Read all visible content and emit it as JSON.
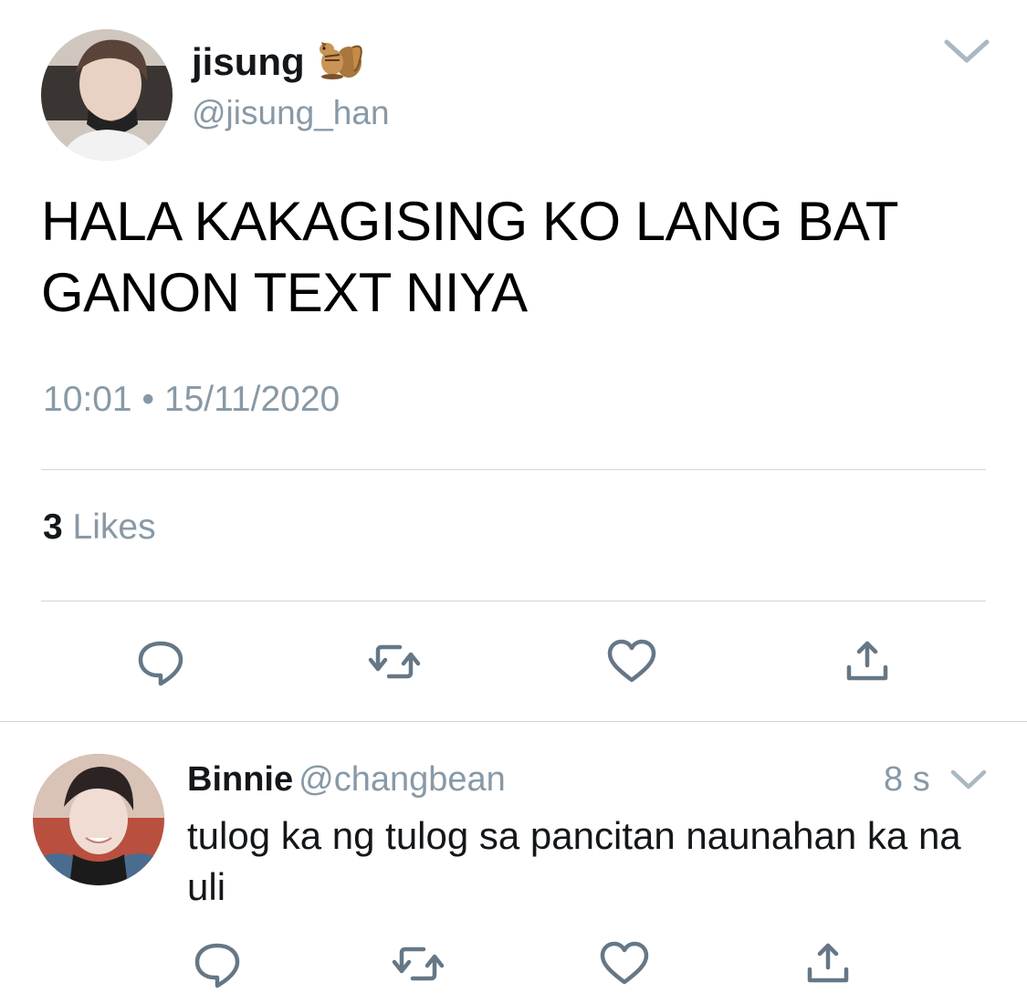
{
  "tweet": {
    "author": {
      "name": "jisung",
      "emoji": "chipmunk-emoji",
      "handle": "@jisung_han",
      "avatar": "profile-photo"
    },
    "text": "HALA KAKAGISING KO LANG BAT GANON TEXT NIYA",
    "timestamp": "10:01 • 15/11/2020",
    "likes": {
      "count": "3",
      "label": "Likes"
    },
    "actions": [
      "reply-icon",
      "retweet-icon",
      "like-icon",
      "share-icon"
    ],
    "menu_icon": "chevron-down-icon"
  },
  "reply": {
    "author": {
      "name": "Binnie",
      "handle": "@changbean",
      "avatar": "profile-photo"
    },
    "time": "8 s",
    "text": "tulog ka ng tulog sa pancitan naunahan ka na uli",
    "actions": [
      "reply-icon",
      "retweet-icon",
      "like-icon",
      "share-icon"
    ],
    "menu_icon": "chevron-down-icon"
  },
  "colors": {
    "text": "#14171a",
    "secondary": "#8899a6",
    "divider": "#cfd6dc",
    "icon": "#657786"
  }
}
